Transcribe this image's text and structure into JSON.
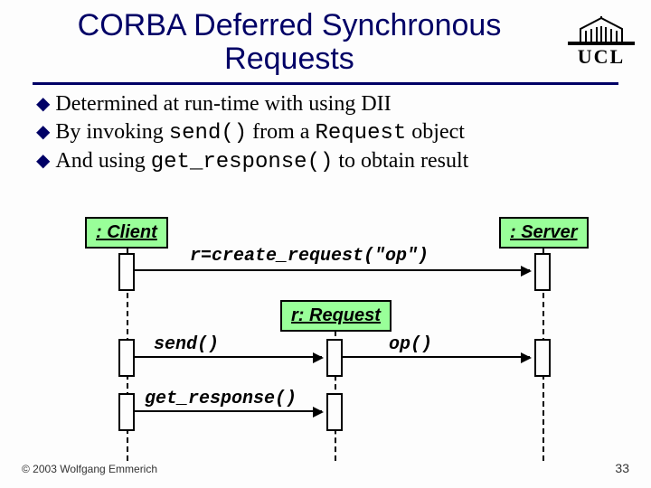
{
  "title_line1": "CORBA Deferred Synchronous",
  "title_line2": "Requests",
  "logo_text": "UCL",
  "bullets": [
    {
      "pre": "Determined at run-time with using DII",
      "code": "",
      "post": ""
    },
    {
      "pre": "By invoking ",
      "code": "send()",
      "mid": " from a ",
      "code2": "Request",
      "post": " object"
    },
    {
      "pre": "And using ",
      "code": "get_response()",
      "mid": "",
      "code2": "",
      "post": " to obtain result"
    }
  ],
  "diagram": {
    "client": ": Client",
    "server": ": Server",
    "request": "r: Request",
    "m_create": "r=create_request(\"op\")",
    "m_send": "send()",
    "m_op": "op()",
    "m_get": "get_response()"
  },
  "footer": {
    "copyright": "© 2003 Wolfgang Emmerich",
    "page": "33"
  }
}
